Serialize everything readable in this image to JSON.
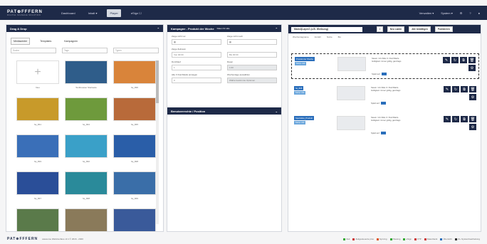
{
  "nav": {
    "logo_main": "PAT⊕FFFERN",
    "logo_sub": "DIGITAL SIGNAGE SOLUTION",
    "items": [
      "Dashboard",
      "Inhalt ▾",
      "Player",
      "eSign ☐"
    ],
    "right_items": [
      "Verwalten ▾",
      "System ▾"
    ]
  },
  "left_panel": {
    "title": "Drag & Drop",
    "tabs": [
      "Mediacenter",
      "Templates",
      "Kampagnen"
    ],
    "filters": [
      "Suche",
      "Tags",
      "Typen"
    ],
    "media": [
      {
        "name": "Neu",
        "color": "#ffffff"
      },
      {
        "name": "Textbrowser Startseite",
        "color": "#2f5d8a"
      },
      {
        "name": "hq_836",
        "color": "#d9843a"
      },
      {
        "name": "hq_841",
        "color": "#c89a2a"
      },
      {
        "name": "hq_844",
        "color": "#6e9a3c"
      },
      {
        "name": "hq_845",
        "color": "#b86a3a"
      },
      {
        "name": "hq_833",
        "color": "#3a6fb8"
      },
      {
        "name": "hq_832",
        "color": "#3aa0c8"
      },
      {
        "name": "hq_828",
        "color": "#2a5ea8"
      },
      {
        "name": "hq_847",
        "color": "#2a4e98"
      },
      {
        "name": "hq_848",
        "color": "#2a8a9a"
      },
      {
        "name": "hq_849",
        "color": "#3a6ea8"
      },
      {
        "name": "",
        "color": "#5a7a4a"
      },
      {
        "name": "",
        "color": "#8a7a5a"
      },
      {
        "name": "",
        "color": "#3a5a9a"
      }
    ]
  },
  "middle_panel": {
    "title": "Kampagne - Produkt der Woche",
    "subtitle": "Daten für alle",
    "fields": [
      {
        "label": "Zeige nicht vor",
        "value": "▦"
      },
      {
        "label": "Zeige nicht nach",
        "value": "▦"
      },
      {
        "label": "Zeige Zeitraum",
        "value": "Von  00:00"
      },
      {
        "label": "",
        "value": "Bis  00:00"
      },
      {
        "label": "Durchlauf",
        "value": "1"
      },
      {
        "label": "Dauer",
        "value": "1:00"
      },
      {
        "label": "Alle X Durchläufe anzeigen",
        "value": "0"
      },
      {
        "label": "Wochentage auswählen",
        "value": "Wähle bestimmte Optionen"
      }
    ],
    "section2_title": "Benutzerrechte / Position"
  },
  "right_panel": {
    "select_value": "Main4(Layer2 (z.B. Werbung)",
    "buttons": [
      "Neu Laden",
      "Alle bestätigen",
      "Publizieren"
    ],
    "filter_labels": [
      "Wochentagname",
      "Anzahl",
      "Nutze",
      "Bis"
    ],
    "slots": [
      {
        "badge": "Produkt der Woche",
        "badge2": "Kamp.-zeit",
        "info1": "Steam / Art-Stile 0 / Durchläufe",
        "info2": "Gültigkeit: immer gültig, ganztags",
        "spiel": "Spielt auf:",
        "dashed": true
      },
      {
        "badge": "hq_826",
        "badge2": "Kamp.-zeit",
        "info1": "Steam / Art-Stile 0 / Durchläufe",
        "info2": "Gültigkeit: immer gültig, ganztags",
        "spiel": "Spielt auf:",
        "dashed": false
      },
      {
        "badge": "Spezielles_Produkt",
        "badge2": "Kamp.-zeit",
        "info1": "Steam / Art-Stile 0 / Durchläufe",
        "info2": "Gültigkeit: immer gültig, ganztags",
        "spiel": "Spielt auf:",
        "dashed": false
      }
    ]
  },
  "footer": {
    "logo": "PAT⊕FFFERN",
    "version": "awesome Webinterface v3.1 © 2016 - 2020",
    "legend": [
      "Zeit",
      "Zeitgesteuerte plus",
      "Syncing",
      "Pausing",
      "eSign",
      "FTP",
      "Datenbank",
      "Übersicht",
      "Zs.-Systembearbeitung"
    ]
  }
}
